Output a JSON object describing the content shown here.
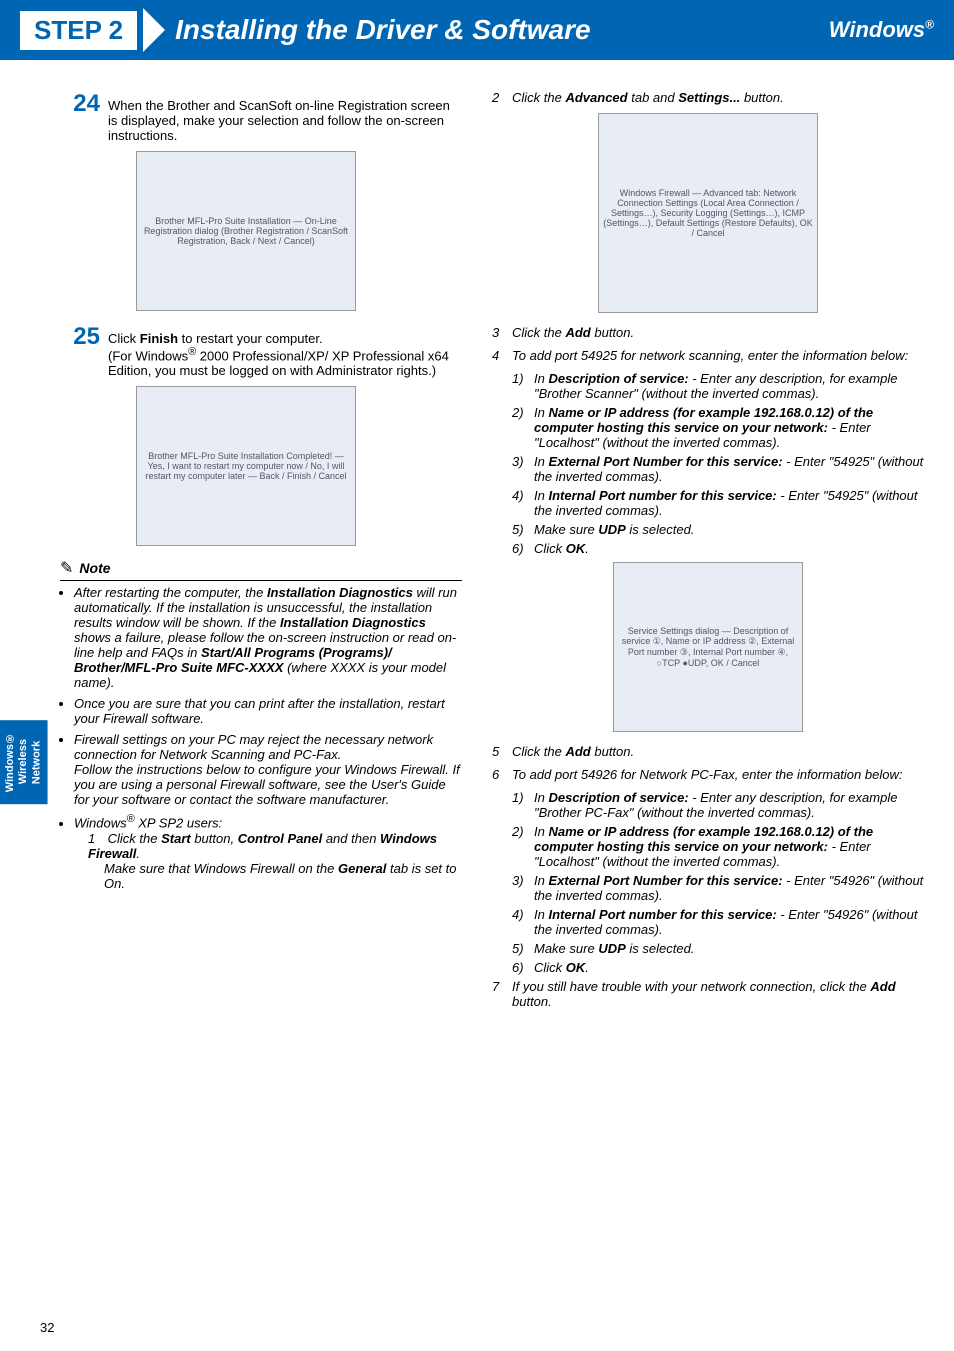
{
  "header": {
    "step": "STEP 2",
    "title": "Installing the Driver & Software",
    "os": "Windows",
    "os_sup": "®"
  },
  "side_tab": {
    "line1": "Windows®",
    "line2": "Wireless",
    "line3": "Network"
  },
  "left": {
    "s24_num": "24",
    "s24_text": "When the Brother and ScanSoft on-line Registration screen is displayed, make your selection and follow the on-screen instructions.",
    "img1_caption": "Brother MFL-Pro Suite Installation — On-Line Registration dialog (Brother Registration / ScanSoft Registration, Back / Next / Cancel)",
    "s25_num": "25",
    "s25_text_a": "Click ",
    "s25_finish": "Finish",
    "s25_text_b": " to restart your computer.",
    "s25_text_c": "(For Windows",
    "s25_sup": "®",
    "s25_text_d": " 2000 Professional/XP/ XP Professional x64 Edition, you must be logged on with Administrator rights.)",
    "img2_caption": "Brother MFL-Pro Suite Installation Completed! — Yes, I want to restart my computer now / No, I will restart my computer later — Back / Finish / Cancel",
    "note_label": "Note",
    "note1_a": "After restarting the computer, the ",
    "note1_b": "Installation Diagnostics",
    "note1_c": " will run automatically. If the installation is unsuccessful, the installation results window will be shown. If the ",
    "note1_d": "Installation Diagnostics",
    "note1_e": " shows a failure, please follow the on-screen instruction or read on-line help and FAQs in ",
    "note1_f": "Start/All Programs (Programs)/ Brother/MFL-Pro Suite MFC-XXXX",
    "note1_g": " (where XXXX is your model name).",
    "note2": "Once you are sure that you can print after the installation, restart your Firewall software.",
    "note3_a": "Firewall settings on your PC may reject the necessary network connection for Network Scanning and PC-Fax.",
    "note3_b": "Follow the instructions below to configure your Windows Firewall. If you are using a personal Firewall software, see the User's Guide for your software or contact the software manufacturer.",
    "note4_a": "Windows",
    "note4_sup": "®",
    "note4_b": " XP SP2 users:",
    "sub1_idx": "1",
    "sub1_a": "Click the ",
    "sub1_b": "Start",
    "sub1_c": " button, ",
    "sub1_d": "Control Panel",
    "sub1_e": " and then ",
    "sub1_f": "Windows Firewall",
    "sub1_g": ".",
    "sub1_h": "Make sure that Windows Firewall on the ",
    "sub1_i": "General",
    "sub1_j": " tab is set to On."
  },
  "right": {
    "r2_idx": "2",
    "r2_a": "Click the ",
    "r2_b": "Advanced",
    "r2_c": " tab and ",
    "r2_d": "Settings...",
    "r2_e": " button.",
    "img3_caption": "Windows Firewall — Advanced tab: Network Connection Settings (Local Area Connection / Settings…), Security Logging (Settings…), ICMP (Settings…), Default Settings (Restore Defaults), OK / Cancel",
    "r3_idx": "3",
    "r3_a": "Click the ",
    "r3_b": "Add",
    "r3_c": " button.",
    "r4_idx": "4",
    "r4_a": "To add port 54925 for network scanning, enter the information below:",
    "r4_1_idx": "1)",
    "r4_1": "In Description of service: - Enter any description, for example \"Brother Scanner\" (without the inverted commas).",
    "r4_2_idx": "2)",
    "r4_2": "In Name or IP address (for example 192.168.0.12) of the computer hosting this service on your network: - Enter \"Localhost\" (without the inverted commas).",
    "r4_3_idx": "3)",
    "r4_3": "In External Port Number for this service: - Enter \"54925\" (without the inverted commas).",
    "r4_4_idx": "4)",
    "r4_4": "In Internal Port number for this service: - Enter \"54925\" (without the inverted commas).",
    "r4_5_idx": "5)",
    "r4_5": "Make sure UDP is selected.",
    "r4_6_idx": "6)",
    "r4_6": "Click OK.",
    "img4_caption": "Service Settings dialog — Description of service ①, Name or IP address ②, External Port number ③, Internal Port number ④, ○TCP ●UDP, OK / Cancel",
    "r5_idx": "5",
    "r5_a": "Click the ",
    "r5_b": "Add",
    "r5_c": " button.",
    "r6_idx": "6",
    "r6_a": "To add port 54926 for Network PC-Fax, enter the information below:",
    "r6_1_idx": "1)",
    "r6_1": "In Description of service: - Enter any description, for example \"Brother PC-Fax\" (without the inverted commas).",
    "r6_2_idx": "2)",
    "r6_2": "In Name or IP address (for example 192.168.0.12) of the computer hosting this service on your network: - Enter \"Localhost\" (without the inverted commas).",
    "r6_3_idx": "3)",
    "r6_3": "In External Port Number for this service: - Enter \"54926\" (without the inverted commas).",
    "r6_4_idx": "4)",
    "r6_4": "In Internal Port number for this service: - Enter \"54926\" (without the inverted commas).",
    "r6_5_idx": "5)",
    "r6_5": "Make sure UDP is selected.",
    "r6_6_idx": "6)",
    "r6_6": "Click OK.",
    "r7_idx": "7",
    "r7_a": "If you still have trouble with your network connection, click the ",
    "r7_b": "Add",
    "r7_c": " button."
  },
  "page_number": "32"
}
